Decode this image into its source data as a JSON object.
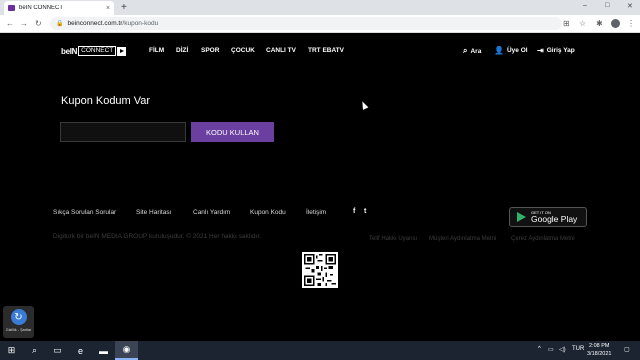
{
  "browser": {
    "tab_title": "beIN CONNECT",
    "tab_close": "×",
    "new_tab": "+",
    "url_domain": "beinconnect.com.tr",
    "url_path": "/kupon-kodu",
    "window_controls": [
      "–",
      "□",
      "✕"
    ]
  },
  "header": {
    "logo_bein": "beIN",
    "logo_connect": "CONNECT",
    "nav": [
      "FİLM",
      "DİZİ",
      "SPOR",
      "ÇOCUK",
      "CANLI TV",
      "TRT EBATV"
    ],
    "search_label": "Ara",
    "signup_label": "Üye Ol",
    "login_label": "Giriş Yap"
  },
  "main": {
    "title": "Kupon Kodum Var",
    "input_value": "",
    "button_label": "KODU KULLAN"
  },
  "footer": {
    "links": [
      "Sıkça Sorulan Sorular",
      "Site Haritası",
      "Canlı Yardım",
      "Kupon Kodu",
      "İletişim"
    ],
    "social": [
      "f",
      "t"
    ],
    "gplay_small": "GET IT ON",
    "gplay_big": "Google Play",
    "copyright": "Digiturk bir beIN MEDIA GROUP kuruluşudur. © 2021 Her hakkı saklıdır.",
    "legal": [
      "Telif Hakkı Uyarısı",
      "Müşteri Aydınlatma Metni",
      "Çerez Aydınlatma Metni"
    ]
  },
  "notification": {
    "text": "Gizlilik - Şartlar"
  },
  "taskbar": {
    "lang": "TUR",
    "time": "2:08 PM",
    "date": "3/18/2021"
  },
  "colors": {
    "accent": "#6a3fa0",
    "background": "#000000",
    "taskbar": "#1c2431"
  }
}
